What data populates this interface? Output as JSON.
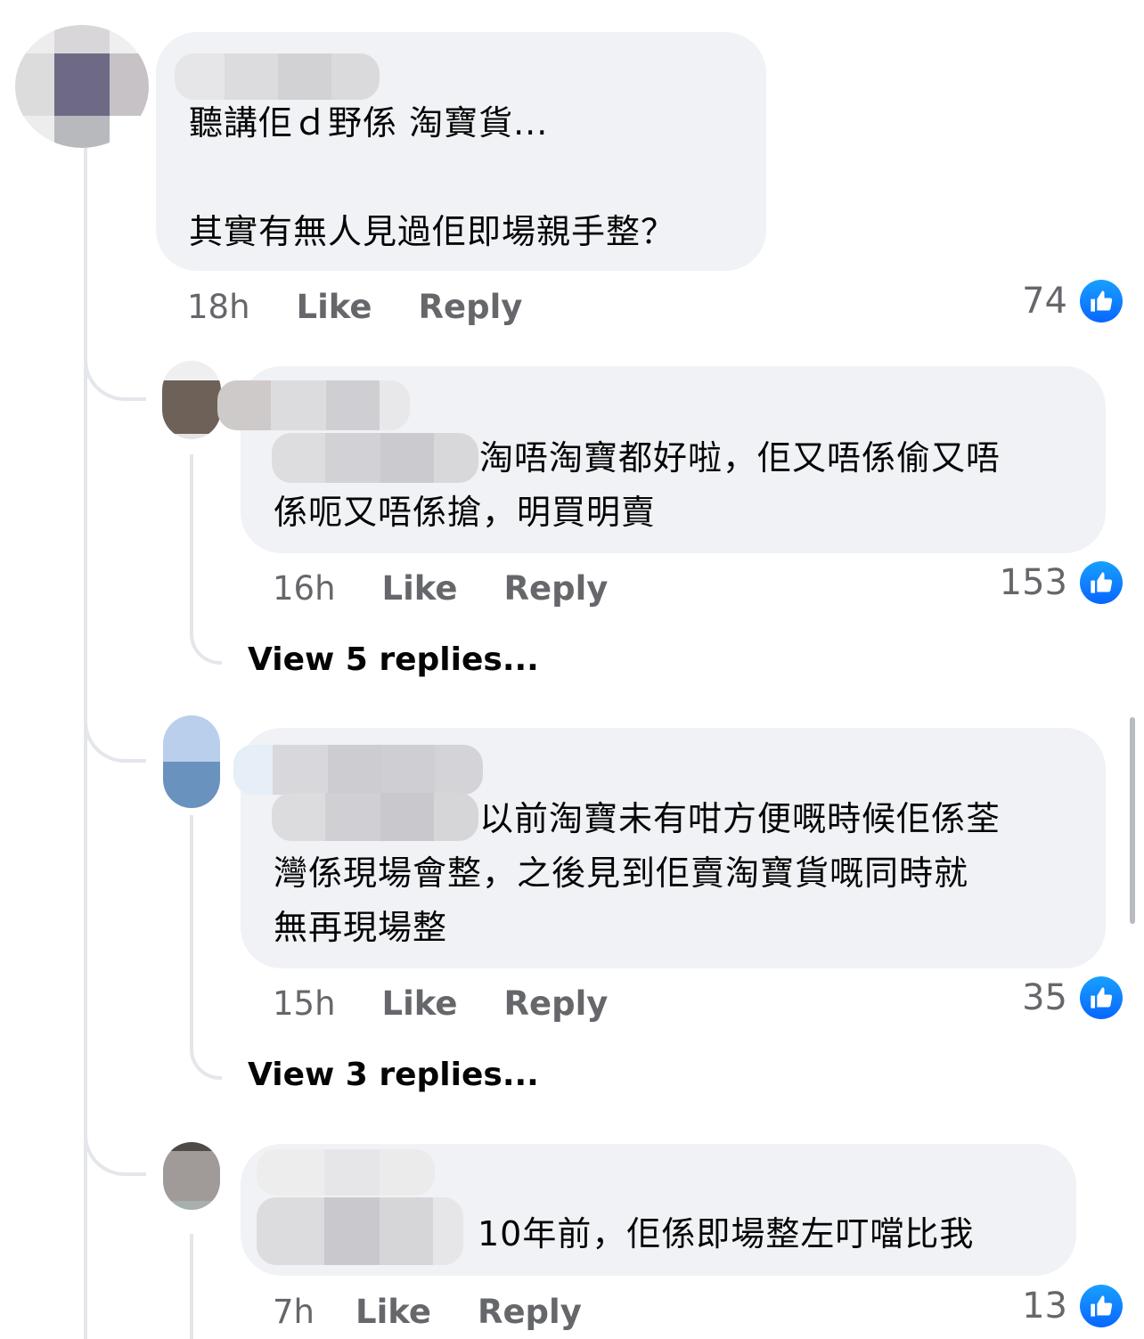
{
  "comments": [
    {
      "text": "聽講佢ｄ野係 淘寶貨...\n\n其實有無人見過佢即場親手整？",
      "time": "18h",
      "like_label": "Like",
      "reply_label": "Reply",
      "likes": "74"
    },
    {
      "text": "淘唔淘寶都好啦，佢又唔係偷又唔\n係呃又唔係搶，明買明賣",
      "time": "16h",
      "like_label": "Like",
      "reply_label": "Reply",
      "likes": "153",
      "view_replies": "View 5 replies..."
    },
    {
      "text": "以前淘寶未有咁方便嘅時候佢係荃\n灣係現場會整，之後見到佢賣淘寶貨嘅同時就\n無再現場整",
      "time": "15h",
      "like_label": "Like",
      "reply_label": "Reply",
      "likes": "35",
      "view_replies": "View 3 replies..."
    },
    {
      "text": "10年前，佢係即場整左叮噹比我",
      "time": "7h",
      "like_label": "Like",
      "reply_label": "Reply",
      "likes": "13"
    }
  ],
  "colors": {
    "bubble": "#f0f2f5",
    "meta_text": "#65676b",
    "like_blue": "#0866ff",
    "thread_line": "#e4e6eb"
  },
  "icons": {
    "like_badge": "thumbs-up-icon"
  }
}
